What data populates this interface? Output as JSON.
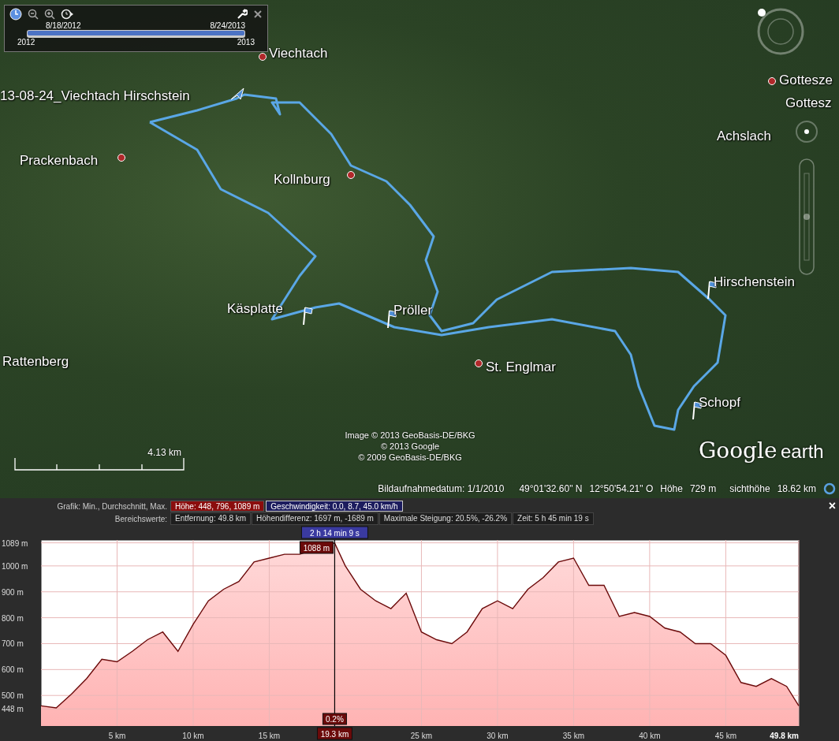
{
  "time_slider": {
    "start_date": "8/18/2012",
    "end_date": "8/24/2013",
    "start_year": "2012",
    "end_year": "2013",
    "level": 1
  },
  "map": {
    "places": [
      {
        "kind": "town",
        "label": "Viechtach"
      },
      {
        "kind": "town",
        "label": "Gottesze"
      },
      {
        "kind": "track",
        "label": "13-08-24_Viechtach Hirschstein"
      },
      {
        "kind": "plain",
        "label": "Gottesz"
      },
      {
        "kind": "plain",
        "label": "Achslach"
      },
      {
        "kind": "town",
        "label": "Prackenbach"
      },
      {
        "kind": "town",
        "label": "Kollnburg"
      },
      {
        "kind": "flag",
        "label": "Hirschenstein"
      },
      {
        "kind": "flag",
        "label": "Käsplatte"
      },
      {
        "kind": "flag",
        "label": "Pröller"
      },
      {
        "kind": "plain",
        "label": "Rattenberg"
      },
      {
        "kind": "town",
        "label": "St. Englmar"
      },
      {
        "kind": "flag",
        "label": "Schopf"
      }
    ],
    "scale": "4.13  km",
    "copyright": [
      "Image © 2013 GeoBasis-DE/BKG",
      "© 2013 Google",
      "© 2009 GeoBasis-DE/BKG"
    ],
    "logo": {
      "brand": "Google",
      "product": "earth"
    },
    "status_bar": {
      "date": "Bildaufnahmedatum: 1/1/2010",
      "lat": "49°01'32.60\" N",
      "lon": "12°50'54.21\" O",
      "elev_label": "Höhe",
      "elev": "729 m",
      "eye_label": "sichthöhe",
      "eye": "18.62 km"
    }
  },
  "stats": {
    "graph_label": "Grafik: Min., Durchschnitt, Max.",
    "graph_buttons": [
      {
        "label": "Höhe: 448, 796, 1089 m",
        "color": "#8b0d0d",
        "selected": true
      },
      {
        "label": "Geschwindigkeit: 0.0, 8.7, 45.0 km/h",
        "color": "#1c1c5e",
        "selected": false
      }
    ],
    "range_label": "Bereichswerte:",
    "range_values": [
      "Entfernung: 49.8 km",
      "Höhendifferenz: 1697 m, -1689 m",
      "Maximale Steigung: 20.5%, -26.2%",
      "Zeit: 5 h 45 min 19 s"
    ],
    "close": "×"
  },
  "profile": {
    "chart_data": {
      "type": "area",
      "x": [
        0,
        1,
        2,
        3,
        4,
        5,
        6,
        7,
        8,
        9,
        10,
        11,
        12,
        13,
        14,
        15,
        16,
        17,
        19.3,
        20,
        21,
        22,
        23,
        24,
        25,
        26,
        27,
        28,
        29,
        30,
        31,
        32,
        33,
        34,
        35,
        36,
        37,
        38,
        39,
        40,
        41,
        42,
        43,
        44,
        45,
        46,
        47,
        48,
        49,
        49.8
      ],
      "series": [
        {
          "color": "#6b0a0a",
          "values": [
            460,
            452,
            505,
            565,
            640,
            630,
            670,
            715,
            745,
            670,
            775,
            865,
            910,
            940,
            1015,
            1030,
            1045,
            1045,
            1088,
            1000,
            910,
            865,
            835,
            895,
            745,
            715,
            700,
            745,
            835,
            865,
            835,
            910,
            955,
            1015,
            1030,
            925,
            925,
            805,
            820,
            805,
            760,
            745,
            700,
            700,
            655,
            550,
            535,
            565,
            535,
            460
          ]
        }
      ],
      "xlim": [
        0,
        49.8
      ],
      "ylim": [
        382,
        1100
      ],
      "grid": true,
      "xticks": [
        {
          "value": 5,
          "label": "5 km"
        },
        {
          "value": 10,
          "label": "10 km"
        },
        {
          "value": 15,
          "label": "15 km"
        },
        {
          "value": 25,
          "label": "25 km"
        },
        {
          "value": 30,
          "label": "30 km"
        },
        {
          "value": 35,
          "label": "35 km"
        },
        {
          "value": 40,
          "label": "40 km"
        },
        {
          "value": 45,
          "label": "45 km"
        },
        {
          "value": 49.8,
          "label": "49.8 km"
        }
      ],
      "yticks": [
        {
          "value": 448,
          "label": "448 m"
        },
        {
          "value": 500,
          "label": "500 m"
        },
        {
          "value": 600,
          "label": "600 m"
        },
        {
          "value": 700,
          "label": "700 m"
        },
        {
          "value": 800,
          "label": "800 m"
        },
        {
          "value": 900,
          "label": "900 m"
        },
        {
          "value": 1000,
          "label": "1000 m"
        },
        {
          "value": 1089,
          "label": "1089 m"
        }
      ],
      "ref_lines": [
        {
          "axis": "x",
          "value": 19.3,
          "label": "19.3 km"
        }
      ]
    },
    "cursor": {
      "time": "2 h 14 min 9 s",
      "elevation": "1088 m",
      "grade": "0.2%"
    }
  }
}
